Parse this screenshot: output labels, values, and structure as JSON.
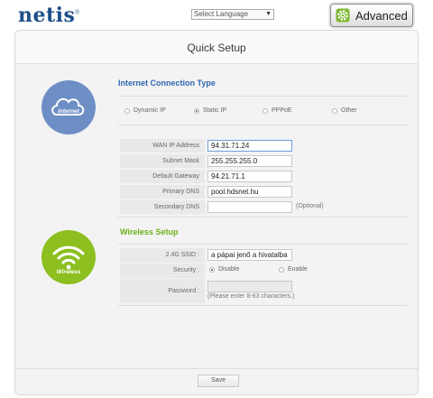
{
  "header": {
    "logo": "netis",
    "logo_mark": "®",
    "language_select": "Select Language",
    "advanced_label": "Advanced",
    "advanced_icon": "gear-icon"
  },
  "page_title": "Quick Setup",
  "internet": {
    "section_title": "Internet Connection Type",
    "icon_label": "internet",
    "connection_types": [
      "Dynamic IP",
      "Static IP",
      "PPPoE",
      "Other"
    ],
    "selected_type": "Static IP",
    "fields": [
      {
        "label": "WAN IP Address",
        "value": "94.31.71.24",
        "note": ""
      },
      {
        "label": "Subnet Mask",
        "value": "255.255.255.0",
        "note": ""
      },
      {
        "label": "Default Gateway",
        "value": "94.21.71.1",
        "note": ""
      },
      {
        "label": "Primary DNS",
        "value": "pool.hdsnet.hu",
        "note": ""
      },
      {
        "label": "Secondary DNS",
        "value": "",
        "note": "(Optional)"
      }
    ]
  },
  "wireless": {
    "section_title": "Wireless Setup",
    "icon_label": "Wireless",
    "ssid_label": "2.4G SSID :",
    "ssid_value": "a pápai jenő a hivatalba",
    "security_label": "Security :",
    "security_options": [
      "Disable",
      "Enable"
    ],
    "security_selected": "Disable",
    "password_label": "Password :",
    "password_value": "",
    "password_hint": "(Please enter 8-63 characters.)"
  },
  "save_label": "Save",
  "colors": {
    "brand_blue": "#1d4f8a",
    "internet_circle": "#6e8fc6",
    "internet_title": "#2f67b1",
    "wireless_circle": "#8cbf1f",
    "wireless_title": "#6fb11a"
  }
}
